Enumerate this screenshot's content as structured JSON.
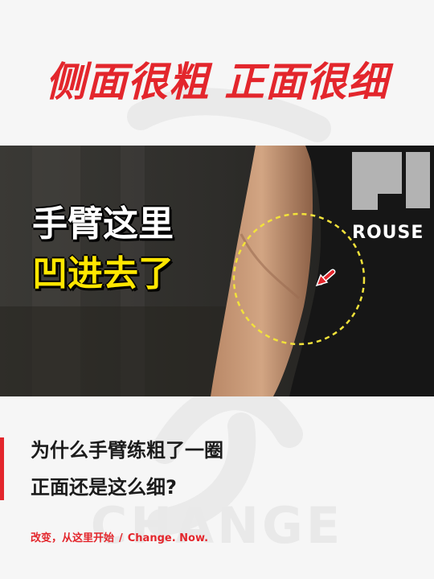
{
  "headline": "侧面很粗 正面很细",
  "caption": {
    "line1": "手臂这里",
    "line2": "凹进去了"
  },
  "shirt_text": "ROUSE",
  "question": {
    "line1": "为什么手臂练粗了一圈",
    "line2": "正面还是这么细?"
  },
  "footer": {
    "slogan": "改变，从这里开始",
    "divider": "/",
    "brand": "Change. Now."
  },
  "watermark_text": "CHANGE",
  "colors": {
    "brand_red": "#e3262c",
    "caption_yellow": "#ffe600",
    "highlight_circle": "#f2e23a"
  }
}
